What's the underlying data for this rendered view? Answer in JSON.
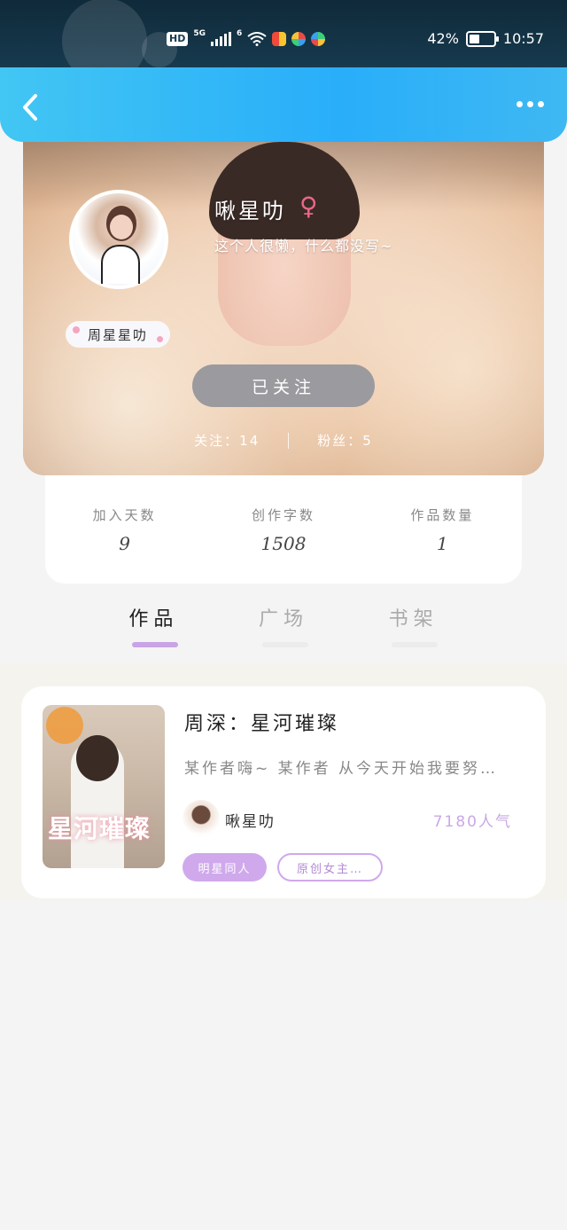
{
  "status_bar": {
    "hd": "HD",
    "net": "5G",
    "wifi_sup": "6",
    "battery_percent": "42%",
    "battery_level": 0.42,
    "time": "10:57"
  },
  "profile": {
    "username": "啾星叻",
    "gender_symbol": "♀",
    "bio": "这个人很懒，什么都没写~",
    "nick_badge": "周星星叻",
    "follow_button": "已关注",
    "following": "关注：14",
    "fans": "粉丝：5"
  },
  "stats": [
    {
      "label": "加入天数",
      "value": "9"
    },
    {
      "label": "创作字数",
      "value": "1508"
    },
    {
      "label": "作品数量",
      "value": "1"
    }
  ],
  "tabs": [
    {
      "label": "作品",
      "active": true
    },
    {
      "label": "广场",
      "active": false
    },
    {
      "label": "书架",
      "active": false
    }
  ],
  "works": [
    {
      "title": "周深：星河璀璨",
      "cover_text": "星河璀璨",
      "description": "某作者嗨~ 某作者 从今天开始我要努…",
      "author": "啾星叻",
      "popularity": "7180人气",
      "tags": [
        "明星同人",
        "原创女主…"
      ]
    }
  ],
  "colors": {
    "header_start": "#42c6f3",
    "header_end": "#29aefa",
    "accent_purple": "#cfa9ec",
    "follow_button_bg": "#9b9a9e",
    "gender_pink": "#e8678a"
  }
}
